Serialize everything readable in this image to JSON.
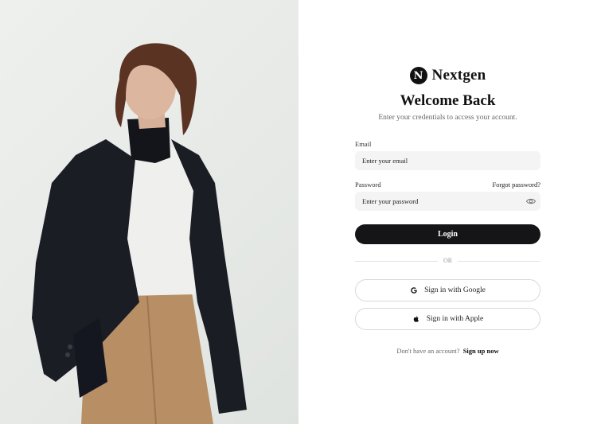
{
  "brand": {
    "logo_letter": "N",
    "name": "Nextgen"
  },
  "header": {
    "title": "Welcome Back",
    "subtitle": "Enter your credentials to access your account."
  },
  "form": {
    "email_label": "Email",
    "email_placeholder": "Enter your email",
    "password_label": "Password",
    "password_placeholder": "Enter your password",
    "forgot_label": "Forgot password?",
    "login_label": "Login"
  },
  "divider": {
    "text": "OR"
  },
  "social": {
    "google_label": "Sign in with Google",
    "apple_label": "Sign in with Apple"
  },
  "footer": {
    "prompt": "Don't have an account?",
    "signup_label": "Sign up now"
  },
  "colors": {
    "primary_button": "#151517",
    "input_background": "#f4f4f4",
    "photo_background": "#e8ebe8"
  },
  "icons": {
    "logo": "n-circle-icon",
    "password_toggle": "eye-icon",
    "google": "google-icon",
    "apple": "apple-icon"
  }
}
